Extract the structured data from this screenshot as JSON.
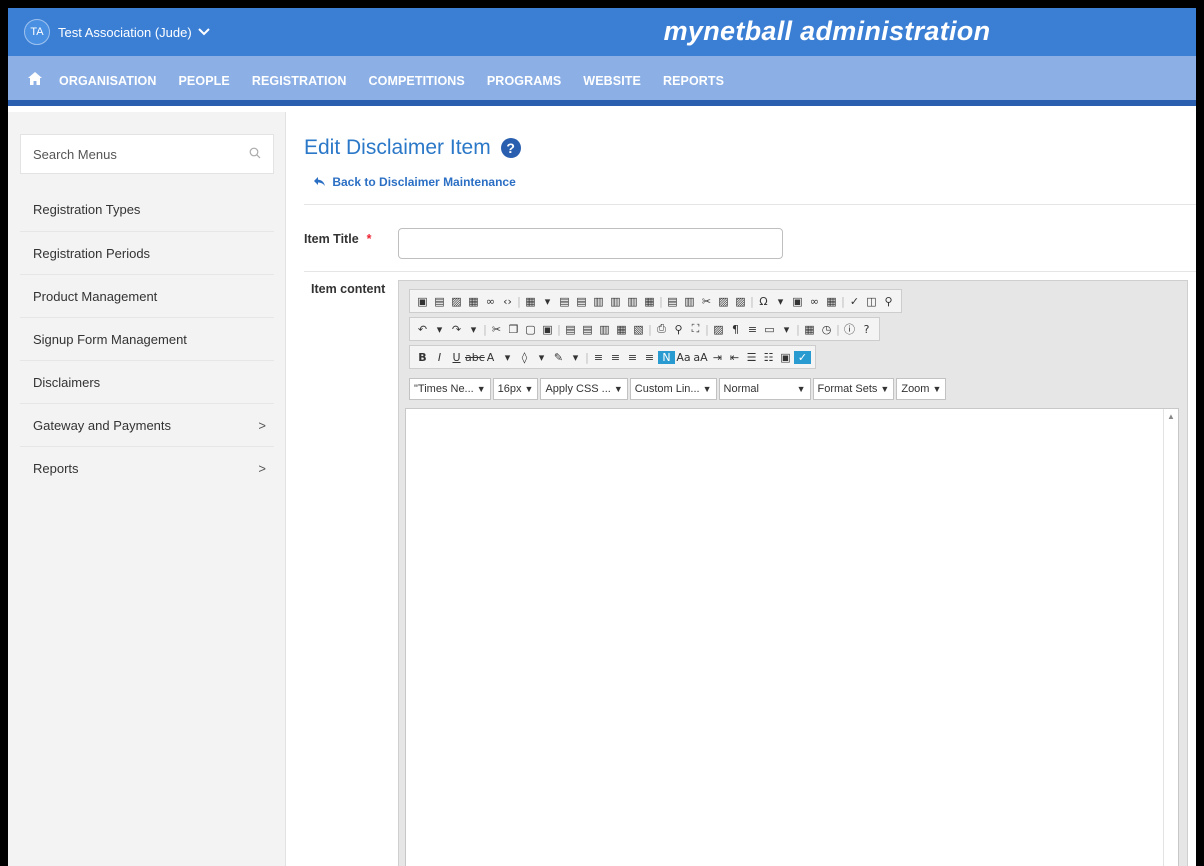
{
  "header": {
    "avatar_initials": "TA",
    "association_name": "Test Association (Jude)",
    "brand": "mynetball administration",
    "colors": {
      "topbar": "#3b7fd5",
      "navbar": "#8cb0e6",
      "accent": "#2b78c8"
    }
  },
  "nav": {
    "home_icon": "home-icon",
    "items": [
      "ORGANISATION",
      "PEOPLE",
      "REGISTRATION",
      "COMPETITIONS",
      "PROGRAMS",
      "WEBSITE",
      "REPORTS"
    ]
  },
  "sidebar": {
    "search_placeholder": "Search Menus",
    "items": [
      {
        "label": "Registration Types"
      },
      {
        "label": "Registration Periods"
      },
      {
        "label": "Product Management"
      },
      {
        "label": "Signup Form Management"
      },
      {
        "label": "Disclaimers"
      },
      {
        "label": "Gateway and Payments",
        "chevron": ">"
      },
      {
        "label": "Reports",
        "chevron": ">"
      }
    ]
  },
  "main": {
    "title": "Edit Disclaimer Item",
    "back_link": "Back to Disclaimer Maintenance",
    "item_title_label": "Item Title",
    "required_marker": "*",
    "item_title_value": "",
    "item_content_label": "Item content"
  },
  "editor": {
    "dropdowns": [
      {
        "label": "\"Times Ne..."
      },
      {
        "label": "16px"
      },
      {
        "label": "Apply CSS ..."
      },
      {
        "label": "Custom Lin..."
      },
      {
        "label": "Normal"
      },
      {
        "label": "Format Sets"
      },
      {
        "label": "Zoom"
      }
    ]
  }
}
